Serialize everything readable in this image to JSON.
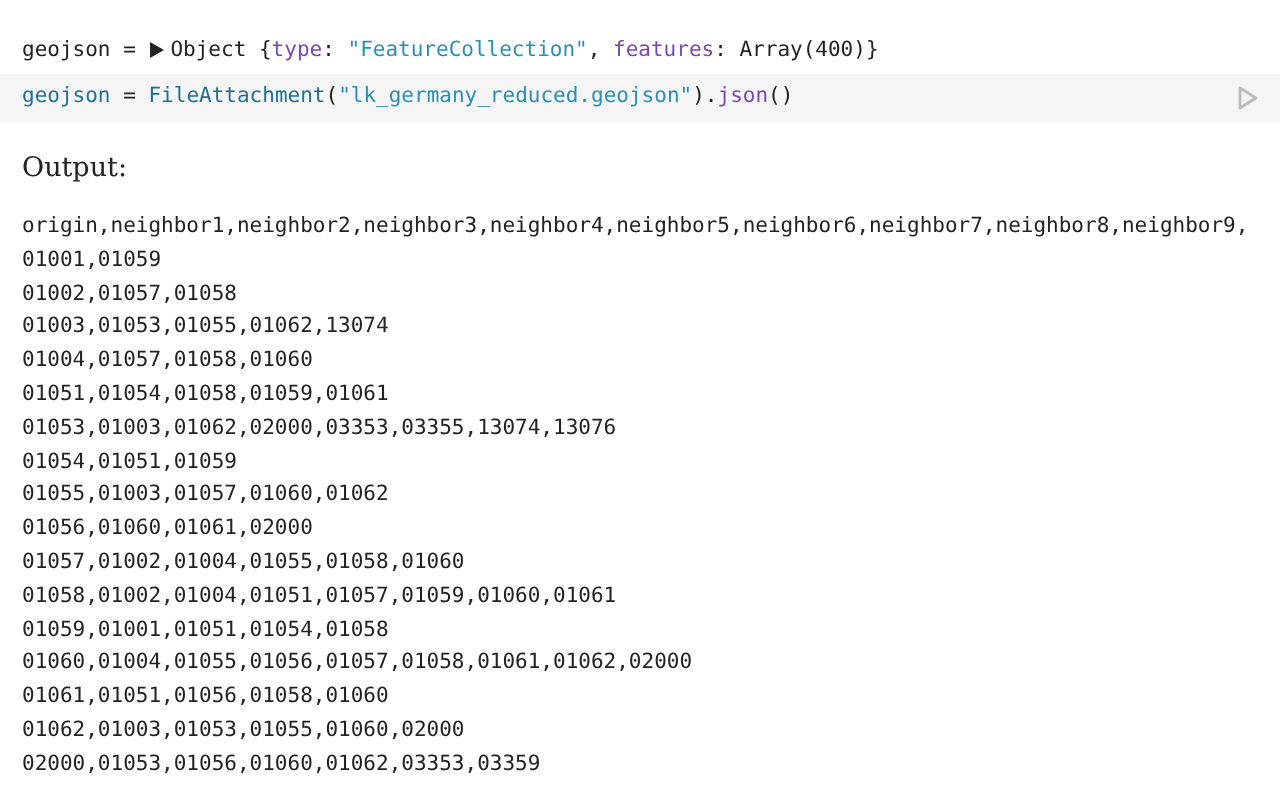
{
  "inspector": {
    "expanded": false,
    "name": "geojson = ",
    "value_tokens": [
      {
        "text": "Object {",
        "kind": "plain"
      },
      {
        "text": "type",
        "kind": "key"
      },
      {
        "text": ": ",
        "kind": "plain"
      },
      {
        "text": "\"FeatureCollection\"",
        "kind": "string"
      },
      {
        "text": ", ",
        "kind": "plain"
      },
      {
        "text": "features",
        "kind": "key"
      },
      {
        "text": ": Array(400)}",
        "kind": "plain"
      }
    ]
  },
  "code_cell": {
    "tokens": [
      {
        "text": "geojson",
        "kind": "variable"
      },
      {
        "text": " = ",
        "kind": "plain"
      },
      {
        "text": "FileAttachment",
        "kind": "variable"
      },
      {
        "text": "(",
        "kind": "plain"
      },
      {
        "text": "\"lk_germany_reduced.geojson\"",
        "kind": "string"
      },
      {
        "text": ").",
        "kind": "plain"
      },
      {
        "text": "json",
        "kind": "key"
      },
      {
        "text": "()",
        "kind": "plain"
      }
    ]
  },
  "output_label": "Output:",
  "output_lines": [
    "origin,neighbor1,neighbor2,neighbor3,neighbor4,neighbor5,neighbor6,neighbor7,neighbor8,neighbor9,",
    "01001,01059",
    "01002,01057,01058",
    "01003,01053,01055,01062,13074",
    "01004,01057,01058,01060",
    "01051,01054,01058,01059,01061",
    "01053,01003,01062,02000,03353,03355,13074,13076",
    "01054,01051,01059",
    "01055,01003,01057,01060,01062",
    "01056,01060,01061,02000",
    "01057,01002,01004,01055,01058,01060",
    "01058,01002,01004,01051,01057,01059,01060,01061",
    "01059,01001,01051,01054,01058",
    "01060,01004,01055,01056,01057,01058,01061,01062,02000",
    "01061,01051,01056,01058,01060",
    "01062,01003,01053,01055,01060,02000",
    "02000,01053,01056,01060,01062,03353,03359"
  ]
}
